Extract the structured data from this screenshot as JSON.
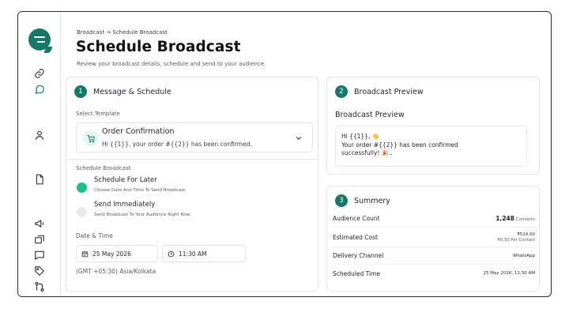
{
  "header": {
    "breadcrumb": "Broadcast → Schedule Broadcast",
    "title": "Schedule Broadcast",
    "subtitle": "Review your broadcast details, schedule and send to your audience."
  },
  "sidebar": {
    "icons": [
      "link-icon",
      "chat-icon",
      "user-icon",
      "file-icon",
      "megaphone-icon",
      "broadcast-icon",
      "message-icon",
      "tag-icon",
      "flow-icon"
    ]
  },
  "message_schedule": {
    "step": "1",
    "title": "Message & Schedule",
    "select_template_label": "Select Template",
    "template": {
      "name": "Order Confirmation",
      "body": "Hi {{1}}, your order #{{2}} has been confirmed."
    },
    "schedule_label": "Schedule Broadcast",
    "options": [
      {
        "title": "Schedule For Later",
        "desc": "Choose Date And Time To Send Broadcast."
      },
      {
        "title": "Send Immediately",
        "desc": "Send Broadcast To Your Audience Right Now."
      }
    ],
    "datetime_label": "Date & Time",
    "date": "25 May 2026",
    "time": "11:30 AM",
    "timezone": "(GMT +05:30) Asia/Kolkata"
  },
  "preview": {
    "step": "2",
    "title": "Broadcast Preview",
    "heading": "Broadcast Preview",
    "line1": "Hi {{1}}, 👋",
    "line2": "Your order #{{2}} has been confirmed",
    "line3": "successfully! 🎉.."
  },
  "summary": {
    "step": "3",
    "title": "Summery",
    "rows": [
      {
        "key": "Audience Count",
        "value": "1,248",
        "unit": "Contacts"
      },
      {
        "key": "Estimated Cost",
        "value": "₹524.00",
        "sub": "₹0.50 Per Contact"
      },
      {
        "key": "Delivery Channel",
        "value": "WhatsApp"
      },
      {
        "key": "Scheduled Time",
        "value": "25 May 2026, 11:30 AM"
      }
    ]
  },
  "colors": {
    "accent": "#17786a",
    "radio_on": "#1fbf89"
  }
}
